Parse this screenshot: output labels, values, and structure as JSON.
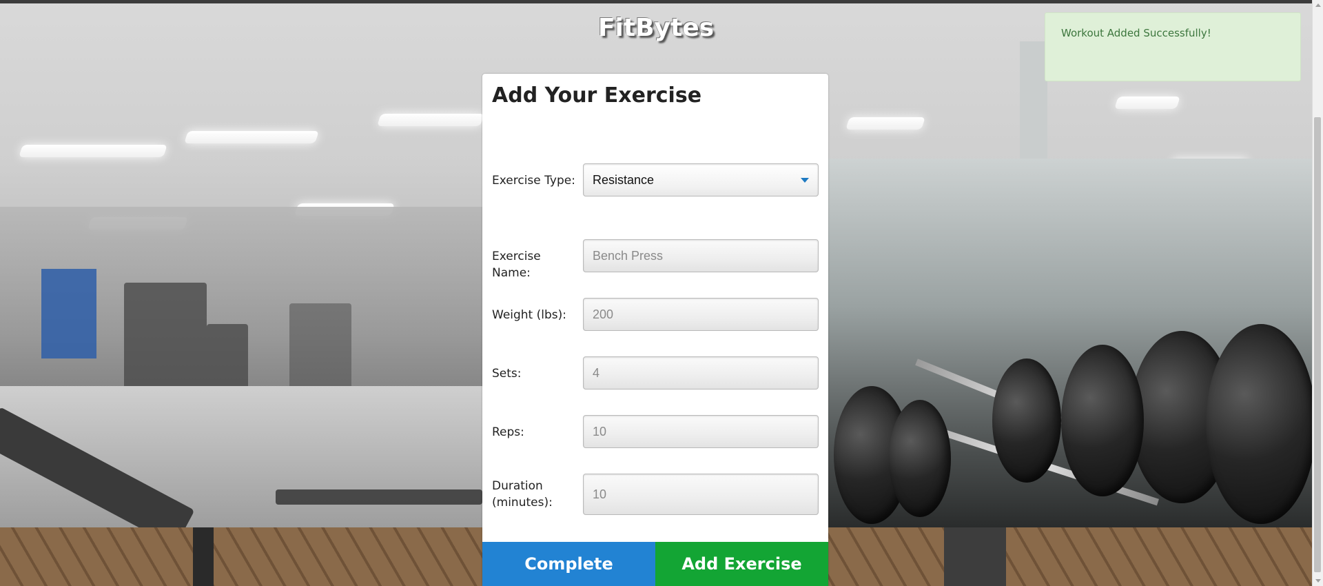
{
  "app": {
    "title": "FitBytes"
  },
  "toast": {
    "message": "Workout Added Successfully!"
  },
  "form": {
    "title": "Add Your Exercise",
    "exercise_type": {
      "label": "Exercise Type:",
      "value": "Resistance"
    },
    "exercise_name": {
      "label": "Exercise Name:",
      "placeholder": "Bench Press"
    },
    "weight": {
      "label": "Weight (lbs):",
      "placeholder": "200"
    },
    "sets": {
      "label": "Sets:",
      "placeholder": "4"
    },
    "reps": {
      "label": "Reps:",
      "placeholder": "10"
    },
    "duration": {
      "label": "Duration (minutes):",
      "placeholder": "10"
    }
  },
  "buttons": {
    "complete": "Complete",
    "add_exercise": "Add Exercise"
  },
  "colors": {
    "complete": "#2283d3",
    "add_exercise": "#13a534",
    "toast_bg": "#dff0d8",
    "toast_text": "#3c763d"
  },
  "icons": {
    "select_caret": "chevron-down-icon"
  }
}
